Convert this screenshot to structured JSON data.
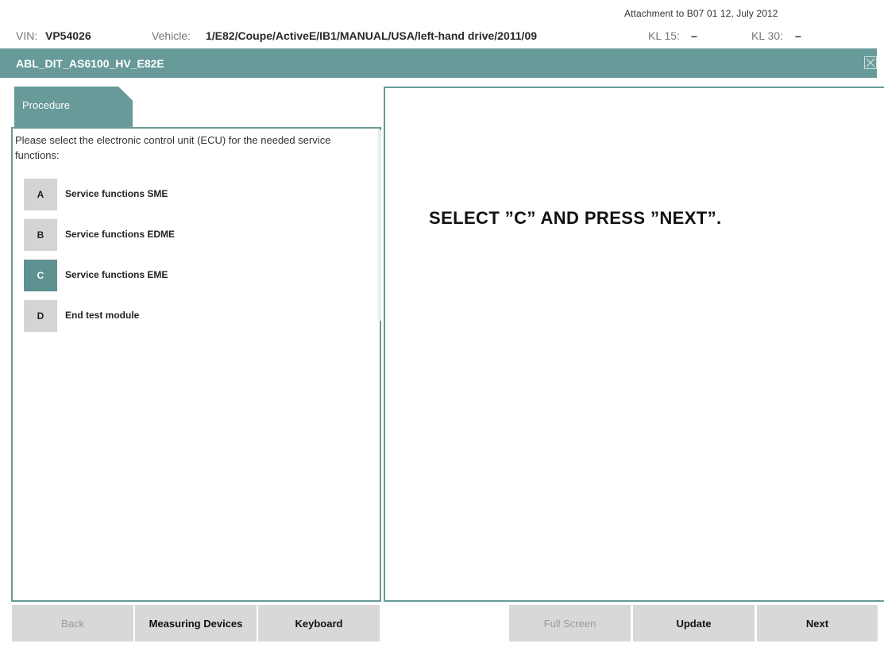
{
  "attachment": "Attachment to B07 01 12, July 2012",
  "info": {
    "vin_label": "VIN:",
    "vin_value": "VP54026",
    "vehicle_label": "Vehicle:",
    "vehicle_value": "1/E82/Coupe/ActiveE/IB1/MANUAL/USA/left-hand drive/2011/09",
    "kl15_label": "KL 15:",
    "kl15_value": "–",
    "kl30_label": "KL 30:",
    "kl30_value": "–"
  },
  "window": {
    "title": "ABL_DIT_AS6100_HV_E82E",
    "close_icon": "close-box-icon"
  },
  "tab": {
    "label": "Procedure"
  },
  "prompt": "Please select the electronic control unit (ECU) for the needed service functions:",
  "options": [
    {
      "key": "A",
      "label": "Service functions SME",
      "selected": false
    },
    {
      "key": "B",
      "label": "Service functions EDME",
      "selected": false
    },
    {
      "key": "C",
      "label": "Service functions EME",
      "selected": true
    },
    {
      "key": "D",
      "label": "End test module",
      "selected": false
    }
  ],
  "instruction": "SELECT ”C” AND PRESS ”NEXT”.",
  "buttons": {
    "back": "Back",
    "measuring_devices": "Measuring Devices",
    "keyboard": "Keyboard",
    "full_screen": "Full Screen",
    "update": "Update",
    "next": "Next"
  },
  "colors": {
    "accent": "#679a98",
    "selected_key": "#5e918f",
    "button_bg": "#d8d8d8",
    "key_bg": "#d4d4d4"
  }
}
